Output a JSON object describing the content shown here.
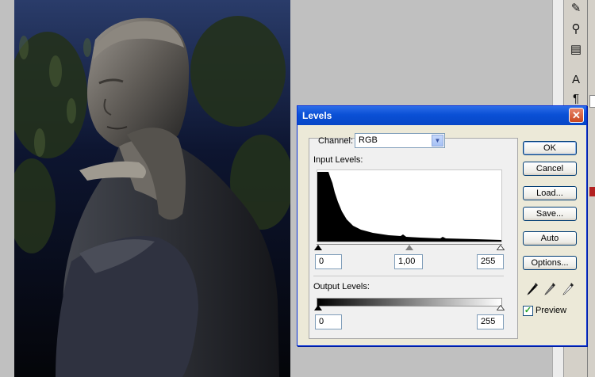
{
  "dialog": {
    "title": "Levels",
    "channel_label": "Channel:",
    "channel_value": "RGB",
    "input_levels_label": "Input Levels:",
    "input_black": "0",
    "input_gamma": "1,00",
    "input_white": "255",
    "output_levels_label": "Output Levels:",
    "output_black": "0",
    "output_white": "255",
    "buttons": {
      "ok": "OK",
      "cancel": "Cancel",
      "load": "Load...",
      "save": "Save...",
      "auto": "Auto",
      "options": "Options..."
    },
    "preview_label": "Preview",
    "preview_checked": true
  },
  "colors": {
    "titlebar": "#0a50d6",
    "dialog_bg": "#ece9d8",
    "workspace": "#c0c0c0"
  },
  "icons": [
    "close-icon",
    "chevron-down-icon",
    "black-eyedropper-icon",
    "gray-eyedropper-icon",
    "white-eyedropper-icon",
    "checkmark-icon"
  ]
}
